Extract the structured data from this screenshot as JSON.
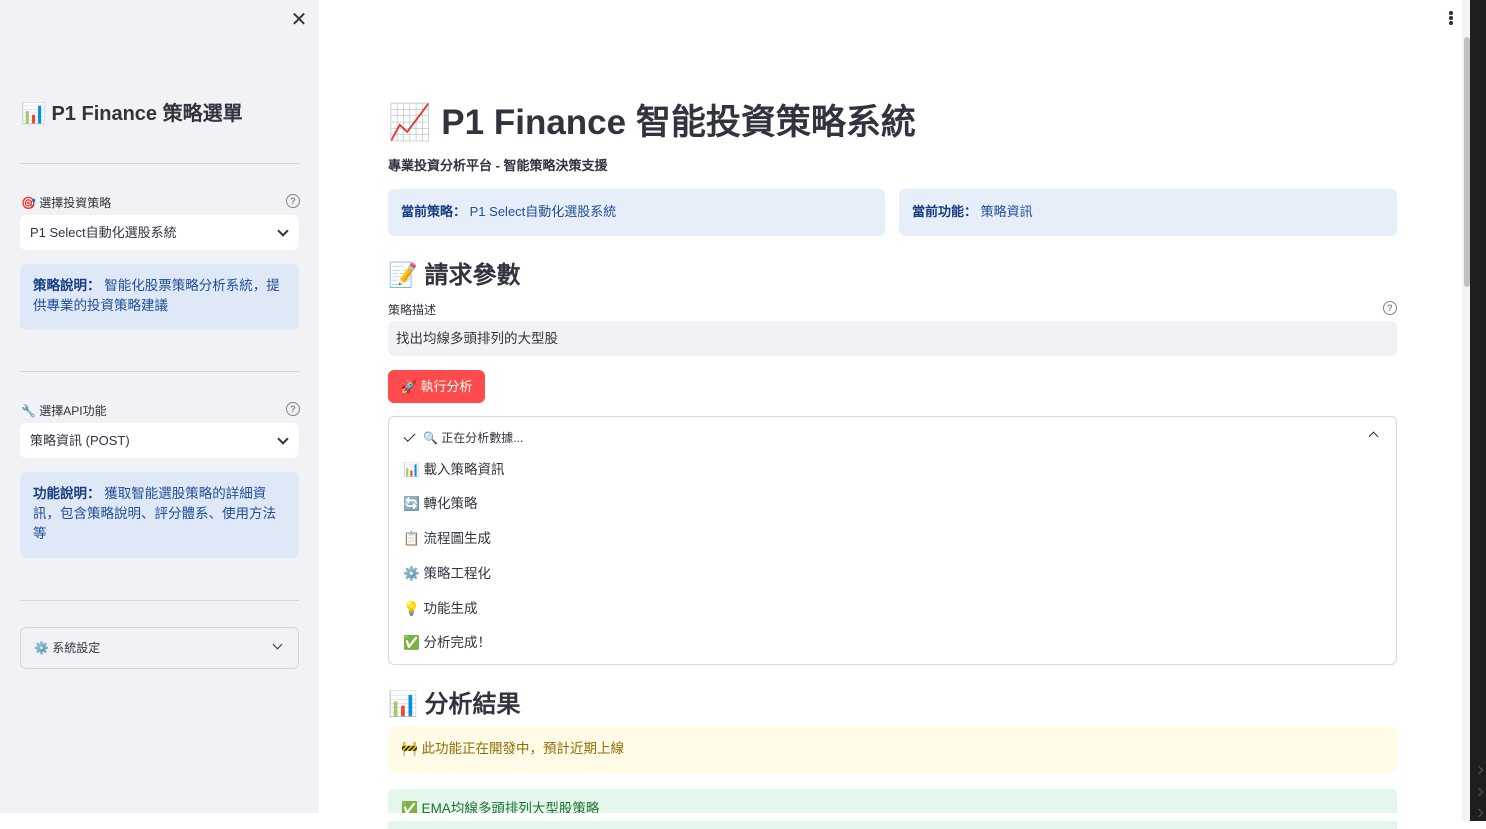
{
  "sidebar": {
    "close_icon": "✕",
    "title": "📊 P1 Finance 策略選單",
    "strategy_label": "🎯 選擇投資策略",
    "strategy_help": "?",
    "strategy_value": "P1 Select自動化選股系統",
    "strategy_info_label": "策略說明：",
    "strategy_info_text": "智能化股票策略分析系統，提供專業的投資策略建議",
    "api_label": "🔧 選擇API功能",
    "api_help": "?",
    "api_value": "策略資訊 (POST)",
    "api_info_label": "功能說明：",
    "api_info_text": "獲取智能選股策略的詳細資訊，包含策略說明、評分體系、使用方法等",
    "settings_label": "⚙️ 系統設定"
  },
  "main": {
    "title": "📈 P1 Finance 智能投資策略系統",
    "subtitle": "專業投資分析平台 - 智能策略決策支援",
    "current_strategy_label": "當前策略：",
    "current_strategy_value": "P1 Select自動化選股系統",
    "current_function_label": "當前功能：",
    "current_function_value": "策略資訊",
    "request_heading": "📝 請求參數",
    "desc_label": "策略描述",
    "desc_help": "?",
    "desc_value": "找出均線多頭排列的大型股",
    "run_button": "🚀 執行分析",
    "status_header": "🔍 正在分析數據...",
    "steps": [
      "📊 載入策略資訊",
      "🔄 轉化策略",
      "📋 流程圖生成",
      "⚙️ 策略工程化",
      "💡 功能生成",
      "✅ 分析完成！"
    ],
    "results_heading": "📊 分析結果",
    "warning_text": "🚧 此功能正在開發中，預計近期上線",
    "success_text": "✅ EMA均線多頭排列大型股策略"
  },
  "colors": {
    "accent": "#ff4b4b",
    "sidebar_bg": "#f0f2f6",
    "info_bg": "#dfe8f6",
    "warning_bg": "#fffbe6",
    "success_bg": "#e5f6ea"
  }
}
